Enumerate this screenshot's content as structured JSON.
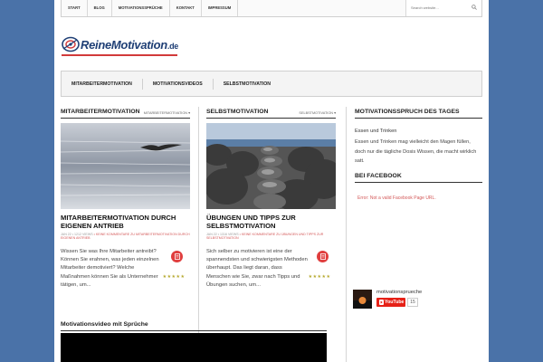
{
  "top_nav": {
    "items": [
      "Start",
      "Blog",
      "Motivationssprüche",
      "Kontakt",
      "Impressum"
    ],
    "search_placeholder": "Search website..."
  },
  "logo": {
    "name": "ReineMotivation",
    "tld": ".de"
  },
  "main_nav": {
    "items": [
      "Mitarbeitermotivation",
      "Motivationsvideos",
      "Selbstmotivation"
    ]
  },
  "section1": {
    "title": "Mitarbeitermotivation",
    "dropdown": "Mitarbeitermotivation",
    "post": {
      "title": "Mitarbeitermotivation durch eigenen Antrieb",
      "meta_date_views": "Jan 22 • 1212 Views",
      "meta_comments": "• Keine Kommentare zu Mitarbeitermotivation durch eigenen Antrieb",
      "excerpt": "Wissen Sie was Ihre Mitarbeiter antreibt? Können Sie erahnen, was jeden einzelnen Mitarbeiter demotiviert? Welche Maßnahmen können Sie als Unternehmer tätigen, um..."
    }
  },
  "section2": {
    "title": "Selbstmotivation",
    "dropdown": "Selbstmotivation",
    "post": {
      "title": "Übungen und Tipps zur Selbstmotivation",
      "meta_date_views": "Jan 22 • 1316 Views",
      "meta_comments": "• Keine Kommentare zu Übungen und Tipps zur Selbstmotivation",
      "excerpt": "Sich selber zu motivieren ist eine der spannendsten und schwierigsten Methoden überhaupt. Das liegt daran, dass Menschen wie Sie, zwar nach Tipps und Übungen suchen, um..."
    }
  },
  "sidebar": {
    "quote_title": "Motivationsspruch des Tages",
    "quote_heading": "Essen und Trinken",
    "quote_text": "Essen und Trinken mag vielleicht den Magen füllen, doch nur die tägliche Dosis Wissen, die macht wirklich satt.",
    "fb_title": "Bei Facebook",
    "fb_error": "Error: Not a valid Facebook Page URL.",
    "yt_channel": "motivationsprueche",
    "yt_button": "YouTube",
    "yt_count": "15"
  },
  "video": {
    "title": "Motivationsvideo mit Sprüche"
  },
  "colors": {
    "background": "#4a72a8",
    "accent": "#d23a3a",
    "meta": "#d35858"
  }
}
